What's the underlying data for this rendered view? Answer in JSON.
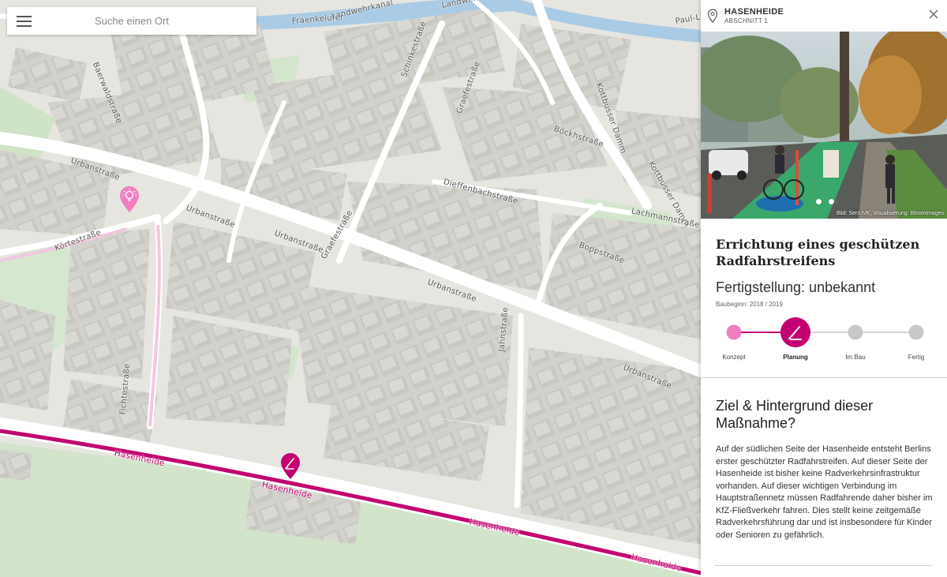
{
  "search": {
    "placeholder": "Suche einen Ort"
  },
  "map": {
    "streets": {
      "landwehrkanal_1": "Landwehrkanal",
      "landwehrkanal_2": "Landwehrkanal",
      "fraenkelufer": "Fraenkelufer",
      "paul_li": "Paul-Li",
      "urbanstrasse_1": "Urbanstraße",
      "urbanstrasse_2": "Urbanstraße",
      "urbanstrasse_3": "Urbanstraße",
      "urbanstrasse_4": "Urbanstraße",
      "urbanstrasse_5": "Urbanstraße",
      "kuerlestrasse": "Körtestraße",
      "graefestrasse_1": "Graefestraße",
      "graefestrasse_2": "Graefestraße",
      "dieffenbachstrasse": "Dieffenbachstraße",
      "kottbusser_damm_1": "Kottbusser Damm",
      "kottbusser_damm_2": "Kottbusser Damm",
      "lachmannstrasse": "Lachmannstraße",
      "boppstrasse": "Boppstraße",
      "jahnstrasse": "Jahnstraße",
      "fichtestrasse": "Fichtestraße",
      "hasenheide_1": "Hasenheide",
      "hasenheide_2": "Hasenheide",
      "hasenheide_3": "Hasenheide",
      "hasenheide_4": "Hasenheide",
      "baerwaldstrasse": "Baerwaldstraße",
      "schinkestrasse": "Schinkestraße",
      "boeckhstrasse": "Böckhstraße"
    },
    "markers": [
      {
        "name": "idea-marker",
        "icon": "lightbulb-icon",
        "color": "#f07fc0"
      },
      {
        "name": "planning-marker",
        "icon": "pencil-icon",
        "color": "#c2006f"
      }
    ]
  },
  "panel": {
    "title": "HASENHEIDE",
    "subtitle": "ABSCHNITT 1",
    "photo_credit": "Bild: SenUVK, Visualisierung: Bloomimages",
    "project_title": "Errichtung eines geschützen Radfahrstreifens",
    "completion": "Fertigstellung: unbekannt",
    "build_start": "Baubeginn: 2018 / 2019",
    "progress": {
      "current_step": 1,
      "steps": [
        {
          "label": "Konzept"
        },
        {
          "label": "Planung"
        },
        {
          "label": "Im Bau"
        },
        {
          "label": "Fertig"
        }
      ],
      "color_done": "#f07fc0",
      "color_active": "#c2006f",
      "color_pending": "#c8c8c8"
    },
    "section_title": "Ziel & Hintergrund dieser Maßnahme?",
    "section_text": "Auf der südlichen Seite der Hasenheide entsteht Berlins erster geschützter Radfahrstreifen. Auf dieser Seite der Hasenheide ist bisher keine Radverkehrsinfrastruktur vorhanden. Auf dieser wichtigen Verbindung im Hauptstraßennetz müssen Radfahrende daher bisher im KfZ-Fließverkehr fahren. Dies stellt keine zeitgemäße Radverkehrsführung dar und ist insbesondere für Kinder oder Senioren zu gefährlich."
  }
}
